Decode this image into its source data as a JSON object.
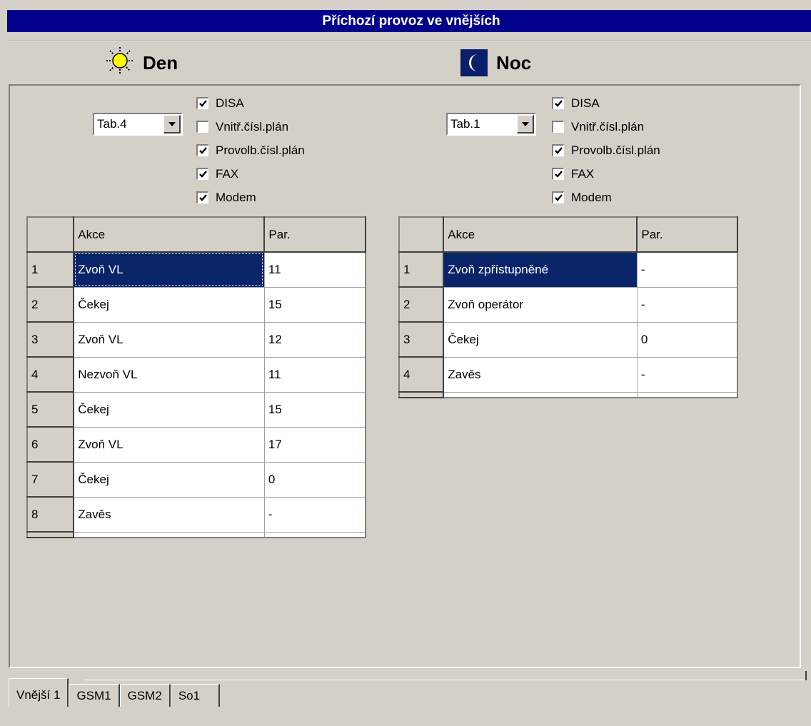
{
  "title": "Příchozí provoz ve vnějších",
  "day": {
    "label": "Den",
    "icon": "sun-icon",
    "table_select": "Tab.4",
    "checkboxes": [
      {
        "label": "DISA",
        "checked": true
      },
      {
        "label": "Vnitř.čísl.plán",
        "checked": false
      },
      {
        "label": "Provolb.čísl.plán",
        "checked": true
      },
      {
        "label": "FAX",
        "checked": true
      },
      {
        "label": "Modem",
        "checked": true
      }
    ],
    "grid": {
      "headers": [
        "Akce",
        "Par."
      ],
      "rows": [
        {
          "num": "1",
          "akce": "Zvoň VL",
          "par": "11"
        },
        {
          "num": "2",
          "akce": "Čekej",
          "par": "15"
        },
        {
          "num": "3",
          "akce": "Zvoň VL",
          "par": "12"
        },
        {
          "num": "4",
          "akce": "Nezvoň VL",
          "par": "11"
        },
        {
          "num": "5",
          "akce": "Čekej",
          "par": "15"
        },
        {
          "num": "6",
          "akce": "Zvoň VL",
          "par": "17"
        },
        {
          "num": "7",
          "akce": "Čekej",
          "par": "0"
        },
        {
          "num": "8",
          "akce": "Zavěs",
          "par": "-"
        }
      ]
    }
  },
  "night": {
    "label": "Noc",
    "icon": "moon-icon",
    "table_select": "Tab.1",
    "checkboxes": [
      {
        "label": "DISA",
        "checked": true
      },
      {
        "label": "Vnitř.čísl.plán",
        "checked": false
      },
      {
        "label": "Provolb.čísl.plán",
        "checked": true
      },
      {
        "label": "FAX",
        "checked": true
      },
      {
        "label": "Modem",
        "checked": true
      }
    ],
    "grid": {
      "headers": [
        "Akce",
        "Par."
      ],
      "rows": [
        {
          "num": "1",
          "akce": "Zvoň zpřístupněné",
          "par": "-"
        },
        {
          "num": "2",
          "akce": "Zvoň operátor",
          "par": "-"
        },
        {
          "num": "3",
          "akce": "Čekej",
          "par": "0"
        },
        {
          "num": "4",
          "akce": "Zavěs",
          "par": "-"
        }
      ]
    }
  },
  "tabs": [
    "Vnější 1",
    "GSM1",
    "GSM2",
    "So1"
  ],
  "active_tab": "Vnější 1",
  "colors": {
    "title_bg": "#00008b",
    "selection": "#0a246a",
    "face": "#d4d0c8"
  }
}
